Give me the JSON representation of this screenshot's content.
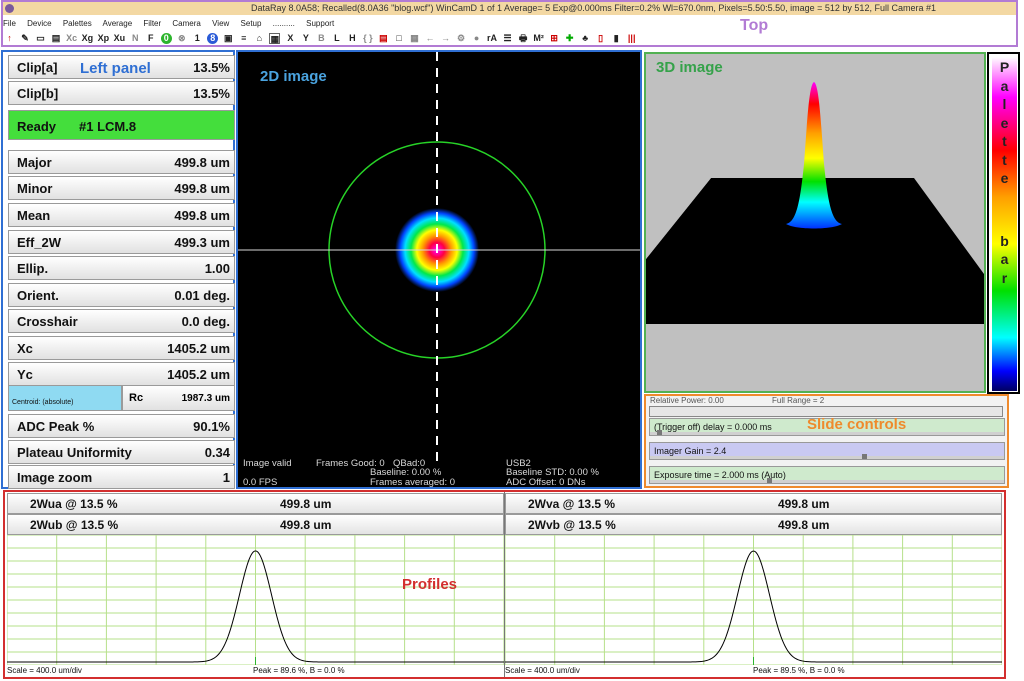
{
  "top": {
    "title": "DataRay 8.0A58; Recalled(8.0A36 \"blog.wcf\")  WinCamD 1 of 1   Average= 5  Exp@0.000ms Filter=0.2%     Wl=670.0nm, Pixels=5.50:5.50, image = 512 by 512, Full   Camera #1",
    "menu": [
      "File",
      "Device",
      "Palettes",
      "Average",
      "Filter",
      "Camera",
      "View",
      "Setup",
      "..........",
      "Support"
    ],
    "annotation": "Top",
    "toolbar": [
      "↑",
      "✎",
      "▭",
      "▤",
      "Xc",
      "Xg",
      "Xp",
      "Xu",
      "N",
      "F",
      "0",
      "⊗",
      "1",
      "8",
      "▣",
      "≡",
      "⌂",
      "▦",
      "X",
      "Y",
      "B",
      "L",
      "H",
      "{ }",
      "▤",
      "□",
      "▦",
      "←",
      "→",
      "⚙",
      "●",
      "rA",
      "☰",
      "🖶",
      "M²",
      "⊞",
      "✚",
      "♣",
      "▯",
      "▮",
      "|||"
    ]
  },
  "left_panel": {
    "annotation": "Left panel",
    "clip_a": {
      "label": "Clip[a]",
      "value": "13.5%"
    },
    "clip_b": {
      "label": "Clip[b]",
      "value": "13.5%"
    },
    "status": {
      "label": "Ready",
      "camera": "#1 LCM.8"
    },
    "rows": [
      {
        "label": "Major",
        "value": "499.8 um"
      },
      {
        "label": "Minor",
        "value": "499.8 um"
      },
      {
        "label": "Mean",
        "value": "499.8 um"
      },
      {
        "label": "Eff_2W",
        "value": "499.3 um"
      },
      {
        "label": "Ellip.",
        "value": "1.00"
      },
      {
        "label": "Orient.",
        "value": "0.01 deg."
      },
      {
        "label": "Crosshair",
        "value": "0.0 deg."
      },
      {
        "label": "Xc",
        "value": "1405.2 um"
      },
      {
        "label": "Yc",
        "value": "1405.2 um"
      }
    ],
    "centroid": {
      "label": "Centroid: (absolute)",
      "rc_label": "Rc",
      "rc_value": "1987.3 um"
    },
    "rows2": [
      {
        "label": "ADC Peak %",
        "value": "90.1%"
      },
      {
        "label": "Plateau Uniformity",
        "value": "0.34"
      },
      {
        "label": "Image zoom",
        "value": "1"
      }
    ]
  },
  "image2d": {
    "annotation": "2D image",
    "stats": {
      "image_valid": "Image valid",
      "frames_good": "Frames Good: 0",
      "qbad": "QBad:0",
      "usb": "USB2",
      "baseline": "Baseline:  0.00 %",
      "baseline_std": "Baseline STD:  0.00 %",
      "fps": "0.0 FPS",
      "frames_avg": "Frames averaged:  0",
      "adc_offset": "ADC Offset:  0 DNs"
    }
  },
  "image3d": {
    "annotation": "3D image"
  },
  "palette": {
    "annotation": "Palette bar",
    "letters": [
      "P",
      "a",
      "l",
      "e",
      "t",
      "t",
      "e",
      "",
      "b",
      "a",
      "r"
    ]
  },
  "slides": {
    "annotation": "Slide controls",
    "relative_power": "Relative Power: 0.00",
    "full_range": "Full Range = 2",
    "trigger": {
      "label": "(Trigger off) delay = 0.000 ms",
      "color": "#cfeacd",
      "level": 0.02
    },
    "gain": {
      "label": "Imager Gain = 2.4",
      "color": "#c9c9f2",
      "level": 0.6
    },
    "exposure": {
      "label": "Exposure time = 2.000 ms (Auto)",
      "color": "#cfeacd",
      "level": 0.33
    }
  },
  "profiles": {
    "annotation": "Profiles",
    "left": {
      "wua": {
        "label": "2Wua @ 13.5 %",
        "value": "499.8 um"
      },
      "wub": {
        "label": "2Wub @ 13.5 %",
        "value": "499.8 um"
      },
      "scale": "Scale = 400.0 um/div",
      "peak": "Peak = 89.6 %,  B = 0.0 %"
    },
    "right": {
      "wva": {
        "label": "2Wva @ 13.5 %",
        "value": "499.8 um"
      },
      "wvb": {
        "label": "2Wvb @ 13.5 %",
        "value": "499.8 um"
      },
      "scale": "Scale = 400.0 um/div",
      "peak": "Peak = 89.5 %,  B = 0.0 %"
    },
    "grid_color": "#b6e08a"
  }
}
